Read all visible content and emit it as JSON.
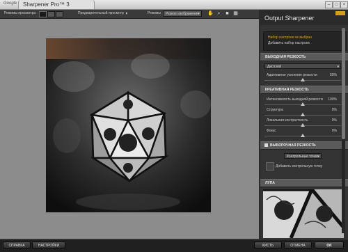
{
  "titlebar": {
    "brand": "Google",
    "title": "Sharpener Pro™ 3"
  },
  "toolbar": {
    "preview_modes_label": "Режимы просмотра",
    "preview_label": "Предварительный просмотр",
    "modes_label": "Режимы",
    "mode_value": "Резкое изображение"
  },
  "panel": {
    "title": "Output Sharpener",
    "preset_none": "Набор настроек не выбран",
    "preset_add": "Добавить набор настроек",
    "sections": {
      "output": "ВЫХОДНАЯ РЕЗКОСТЬ",
      "creative": "КРЕАТИВНАЯ РЕЗКОСТЬ",
      "selective": "ВЫБОРОЧНАЯ РЕЗКОСТЬ",
      "loupe": "ЛУПА"
    },
    "output_device": "Дисплей",
    "adaptive_label": "Адаптивное усиление резкости",
    "adaptive_value": "50%",
    "adaptive_level": 0.5,
    "creative_rows": [
      {
        "label": "Интенсивность выходной резкости",
        "value": "100%",
        "level": 0.5
      },
      {
        "label": "Структура",
        "value": "0%",
        "level": 0.5
      },
      {
        "label": "Локальная контрастность",
        "value": "0%",
        "level": 0.5
      },
      {
        "label": "Фокус",
        "value": "0%",
        "level": 0.5
      }
    ],
    "control_points": "Контрольные точки",
    "add_control_point": "Добавить контрольную точку"
  },
  "bottom": {
    "help": "СПРАВКА",
    "settings": "НАСТРОЙКИ",
    "brush": "КИСТЬ",
    "cancel": "ОТМЕНА",
    "ok": "OK"
  },
  "colors": {
    "accent": "#e8a21b",
    "preview_bg": "#8c8c8c"
  }
}
